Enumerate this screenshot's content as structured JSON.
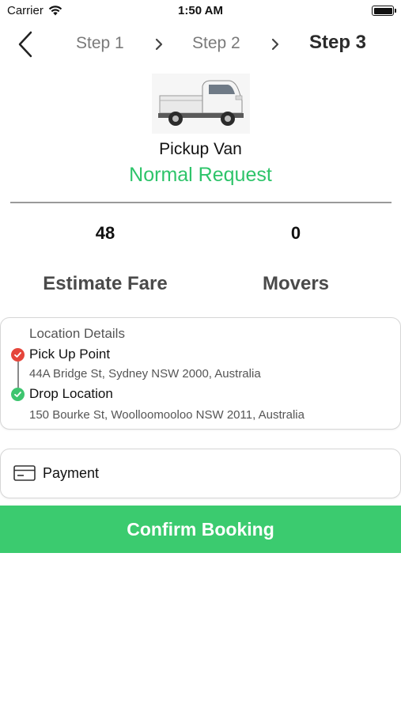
{
  "status_bar": {
    "carrier": "Carrier",
    "time": "1:50 AM",
    "icons": [
      "wifi-icon",
      "battery-icon"
    ]
  },
  "nav": {
    "back_icon": "chevron-left-icon",
    "steps": [
      {
        "label": "Step 1",
        "active": false
      },
      {
        "label": "Step 2",
        "active": false
      },
      {
        "label": "Step 3",
        "active": true
      }
    ],
    "separator_icon": "chevron-right-icon"
  },
  "vehicle": {
    "name": "Pickup Van",
    "request_type": "Normal Request",
    "image": "pickup-van-image"
  },
  "stats": {
    "fare_value": "48",
    "fare_label": "Estimate Fare",
    "movers_value": "0",
    "movers_label": "Movers"
  },
  "location": {
    "title": "Location Details",
    "pickup_label": "Pick Up Point",
    "pickup_address": "44A Bridge St, Sydney NSW 2000, Australia",
    "drop_label": "Drop Location",
    "drop_address": "150 Bourke St, Woolloomooloo NSW 2011, Australia"
  },
  "payment": {
    "label": "Payment",
    "icon": "credit-card-icon"
  },
  "confirm": {
    "label": "Confirm Booking"
  },
  "colors": {
    "accent_green": "#3bcb6f",
    "request_green": "#2ec46a",
    "pickup_red": "#e5463b",
    "drop_green": "#3ec56f"
  }
}
